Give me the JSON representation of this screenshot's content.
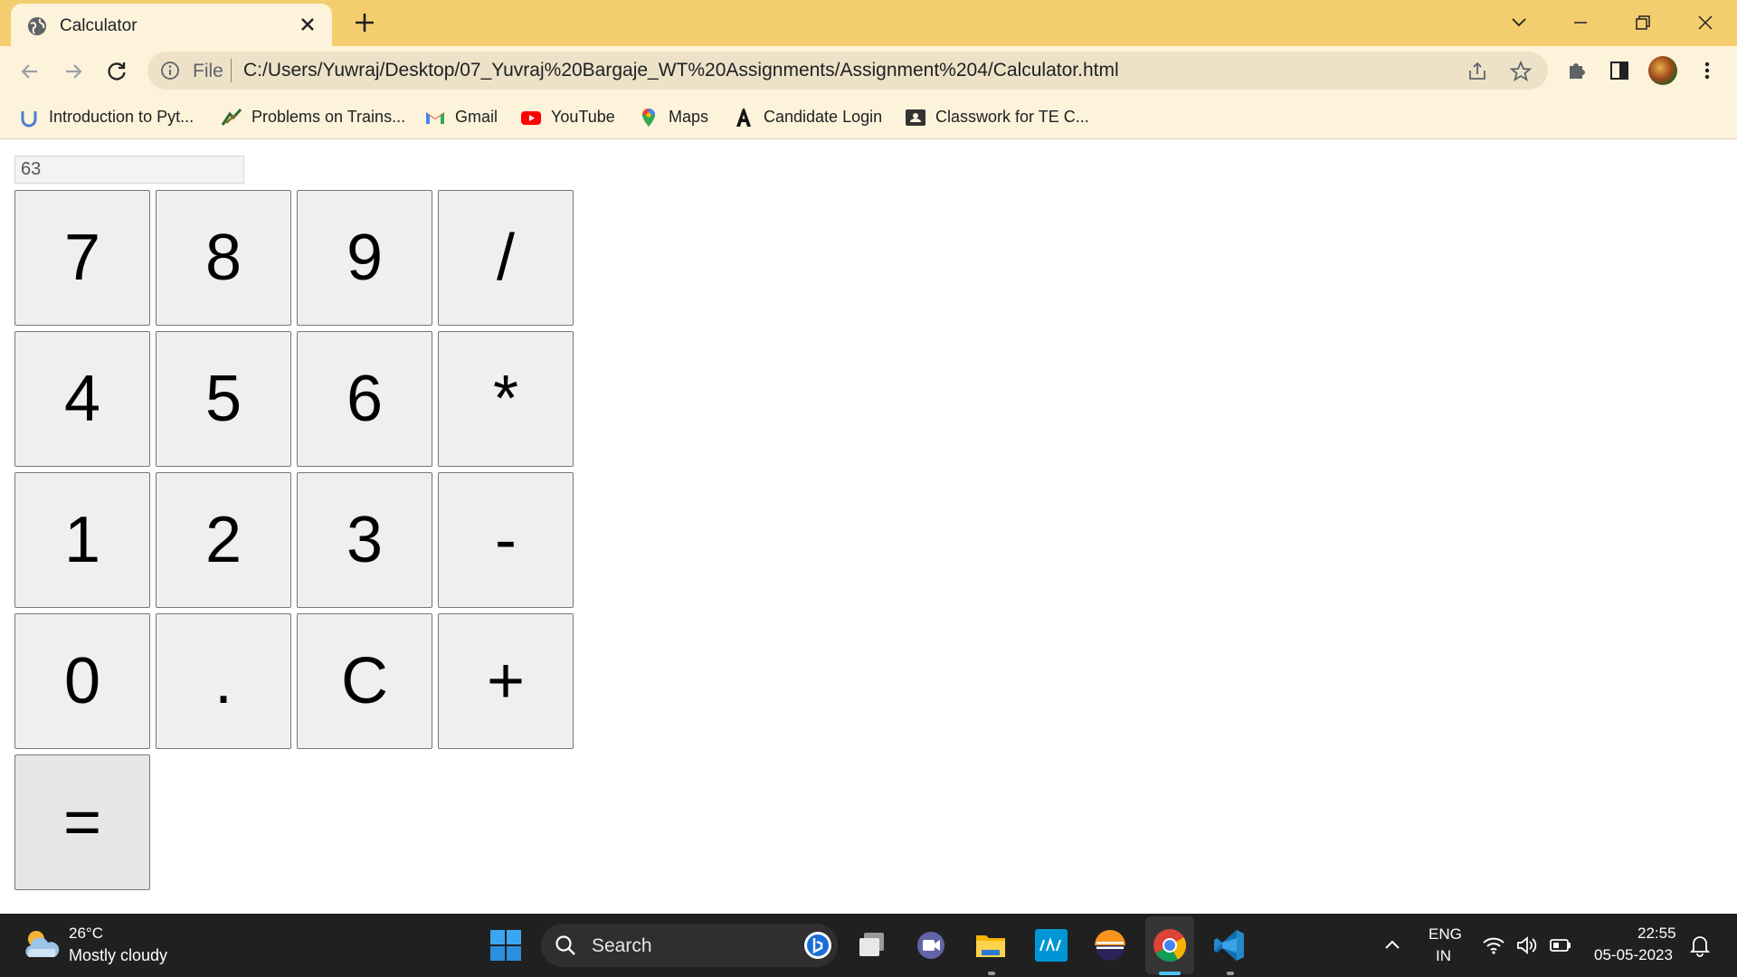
{
  "tab": {
    "title": "Calculator"
  },
  "omnibox": {
    "scheme_label": "File",
    "url": "C:/Users/Yuwraj/Desktop/07_Yuvraj%20Bargaje_WT%20Assignments/Assignment%204/Calculator.html"
  },
  "bookmarks": [
    {
      "label": "Introduction to Pyt...",
      "icon": "udemy-icon"
    },
    {
      "label": "Problems on Trains...",
      "icon": "train-icon"
    },
    {
      "label": "Gmail",
      "icon": "gmail-icon"
    },
    {
      "label": "YouTube",
      "icon": "youtube-icon"
    },
    {
      "label": "Maps",
      "icon": "maps-icon"
    },
    {
      "label": "Candidate Login",
      "icon": "candidate-icon"
    },
    {
      "label": "Classwork for TE C...",
      "icon": "classroom-icon"
    }
  ],
  "calculator": {
    "display_value": "63",
    "keys": [
      "7",
      "8",
      "9",
      "/",
      "4",
      "5",
      "6",
      "*",
      "1",
      "2",
      "3",
      "-",
      "0",
      ".",
      "C",
      "+",
      "="
    ]
  },
  "taskbar": {
    "weather_temp": "26°C",
    "weather_condition": "Mostly cloudy",
    "search_label": "Search",
    "lang_line1": "ENG",
    "lang_line2": "IN",
    "time": "22:55",
    "date": "05-05-2023"
  },
  "colors": {
    "tabstrip": "#f4cd6e",
    "toolbar": "#fdf3da",
    "key_bg": "#efefef",
    "taskbar": "#202020"
  }
}
